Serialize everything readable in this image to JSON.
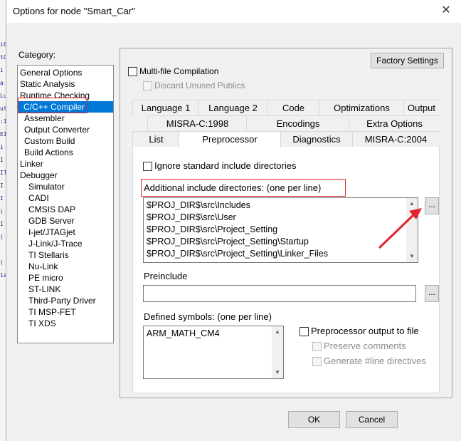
{
  "window": {
    "title": "Options for node \"Smart_Car\"",
    "close_glyph": "✕"
  },
  "background_glyphs": [
    "i0",
    "tC",
    "i",
    "a",
    "Lu",
    "ut",
    ":I",
    "EI",
    "i",
    "I",
    "IT",
    "I",
    "I",
    "(",
    "I",
    "(",
    "",
    "(",
    "1a"
  ],
  "category": {
    "label": "Category:",
    "items": [
      "General Options",
      "Static Analysis",
      "Runtime Checking",
      "C/C++ Compiler",
      "Assembler",
      "Output Converter",
      "Custom Build",
      "Build Actions",
      "Linker",
      "Debugger",
      "Simulator",
      "CADI",
      "CMSIS DAP",
      "GDB Server",
      "I-jet/JTAGjet",
      "J-Link/J-Trace",
      "TI Stellaris",
      "Nu-Link",
      "PE micro",
      "ST-LINK",
      "Third-Party Driver",
      "TI MSP-FET",
      "TI XDS"
    ],
    "selected": "C/C++ Compiler"
  },
  "panel": {
    "factory_settings": "Factory Settings",
    "multifile_label": "Multi-file Compilation",
    "discard_label": "Discard Unused Publics",
    "tabs_row1": [
      "Language 1",
      "Language 2",
      "Code",
      "Optimizations",
      "Output"
    ],
    "tabs_row2": [
      "MISRA-C:1998",
      "Encodings",
      "Extra Options"
    ],
    "tabs_row3": [
      "List",
      "Preprocessor",
      "Diagnostics",
      "MISRA-C:2004"
    ],
    "active_tab": "Preprocessor",
    "ignore_std_label": "Ignore standard include directories",
    "include_dirs_label": "Additional include directories: (one per line)",
    "include_dirs": [
      "$PROJ_DIR$\\src\\Includes",
      "$PROJ_DIR$\\src\\User",
      "$PROJ_DIR$\\src\\Project_Setting",
      "$PROJ_DIR$\\src\\Project_Setting\\Startup",
      "$PROJ_DIR$\\src\\Project_Setting\\Linker_Files"
    ],
    "browse_label": "...",
    "preinclude_label": "Preinclude",
    "preinclude_value": "",
    "defined_symbols_label": "Defined symbols: (one per line)",
    "defined_symbols": [
      "ARM_MATH_CM4"
    ],
    "preproc_output_label": "Preprocessor output to file",
    "preserve_comments_label": "Preserve comments",
    "generate_line_label": "Generate #line directives"
  },
  "buttons": {
    "ok": "OK",
    "cancel": "Cancel"
  },
  "colors": {
    "selection": "#0078d7",
    "annotation_red": "#e0242b"
  }
}
